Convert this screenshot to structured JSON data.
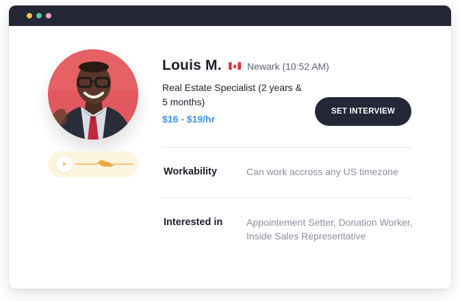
{
  "window": {
    "dots": [
      {
        "name": "yellow",
        "color": "#f5c544"
      },
      {
        "name": "green",
        "color": "#54c7a1"
      },
      {
        "name": "pink",
        "color": "#f5a3b6"
      }
    ],
    "titlebar_color": "#232737"
  },
  "profile": {
    "name": "Louis M.",
    "flag_icon": "canada-flag-icon",
    "location": "Newark (10:52 AM)",
    "role": "Real Estate Specialist (2 years & 5 months)",
    "rate": "$16 - $19/hr",
    "rate_color": "#3f8ff0",
    "avatar_bg": "#e2585e"
  },
  "audio": {
    "play_icon": "play-icon",
    "wave_color": "#f2a33a",
    "pill_color": "#fdf4df"
  },
  "actions": {
    "set_interview_label": "SET INTERVIEW"
  },
  "details": [
    {
      "label": "Workability",
      "value": "Can work accross any US timezone"
    },
    {
      "label": "Interested in",
      "value": "Appointement Setter, Donation Worker, Inside Sales Representative"
    }
  ]
}
